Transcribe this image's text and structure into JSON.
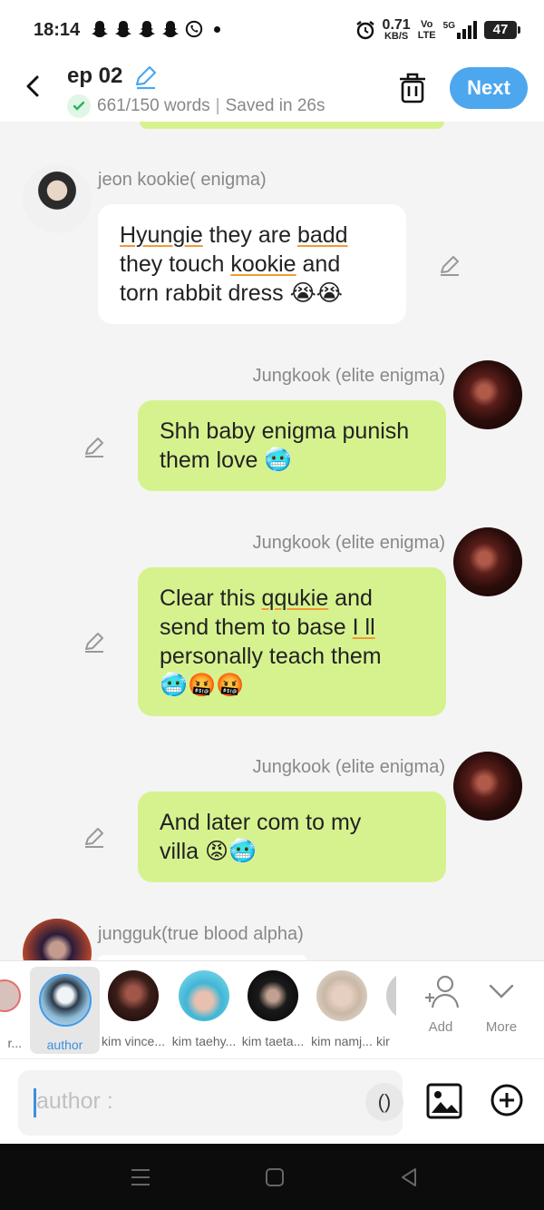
{
  "status_bar": {
    "time": "18:14",
    "speed_value": "0.71",
    "speed_unit": "KB/S",
    "volte_top": "Vo",
    "volte_bottom": "LTE",
    "network": "5G",
    "battery": "47"
  },
  "header": {
    "title": "ep 02",
    "word_count": "661/150 words",
    "saved": "Saved in 26s",
    "next_label": "Next"
  },
  "messages": [
    {
      "speaker": "jeon kookie( enigma)",
      "side": "left",
      "lines": [
        "Hyungie they are badd",
        "they touch kookie and",
        "torn rabbit dress 😭😭"
      ]
    },
    {
      "speaker": "Jungkook (elite enigma)",
      "side": "right",
      "lines": [
        "Shh baby enigma punish",
        "them love 🥶"
      ]
    },
    {
      "speaker": "Jungkook (elite enigma)",
      "side": "right",
      "lines": [
        "Clear this qqukie and",
        "send them to base I ll",
        "personally teach them",
        "🥶🤬🤬"
      ]
    },
    {
      "speaker": "Jungkook (elite enigma)",
      "side": "right",
      "lines": [
        "And later com to my",
        "villa 😡🥶"
      ]
    },
    {
      "speaker": "jungguk(true blood alpha)",
      "side": "left",
      "lines": []
    }
  ],
  "characters": [
    {
      "label": "r...",
      "color": "#d8c0bb"
    },
    {
      "label": "author",
      "color": "#7fb0cf",
      "selected": true
    },
    {
      "label": "kim vince...",
      "color": "#3a1d18"
    },
    {
      "label": "kim taehy...",
      "color": "#3fb6d6"
    },
    {
      "label": "kim taeta...",
      "color": "#1a1a1a"
    },
    {
      "label": "kim namj...",
      "color": "#c9b8a6"
    },
    {
      "label": "kir",
      "color": "#cfcfcf"
    }
  ],
  "actions": {
    "add_label": "Add",
    "more_label": "More"
  },
  "input": {
    "placeholder": "author :",
    "paren_label": "()"
  },
  "icons": [
    "back-icon",
    "pencil-icon",
    "check-icon",
    "trash-icon",
    "edit-icon",
    "add-person-icon",
    "chevron-down-icon",
    "image-icon",
    "plus-circle-icon",
    "menu-icon",
    "home-icon",
    "back-triangle-icon"
  ],
  "colors": {
    "accent": "#4da7ef",
    "bubble_right": "#d6f28f",
    "bubble_left": "#ffffff"
  }
}
